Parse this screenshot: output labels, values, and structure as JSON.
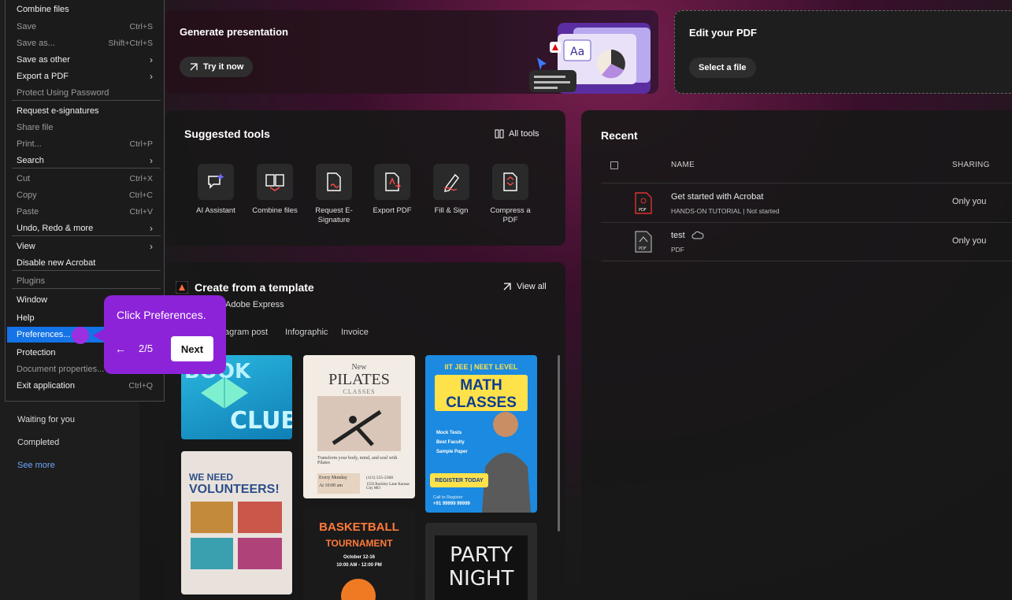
{
  "sidebar": {
    "links": [
      "Waiting for you",
      "Completed",
      "See more"
    ]
  },
  "banner": {
    "generate_title": "Generate presentation",
    "generate_button": "Try it now",
    "edit_title": "Edit your PDF",
    "edit_button": "Select a file"
  },
  "tools": {
    "title": "Suggested tools",
    "all_tools": "All tools",
    "items": [
      {
        "label": "AI Assistant",
        "icon": "ai-assistant-icon"
      },
      {
        "label": "Combine files",
        "icon": "combine-files-icon"
      },
      {
        "label": "Request E-Signature",
        "icon": "request-esignature-icon"
      },
      {
        "label": "Export PDF",
        "icon": "export-pdf-icon"
      },
      {
        "label": "Fill & Sign",
        "icon": "fill-sign-icon"
      },
      {
        "label": "Compress a PDF",
        "icon": "compress-pdf-icon"
      }
    ]
  },
  "templates": {
    "title": "Create from a template",
    "subtitle": "Adobe Express",
    "view_all": "View all",
    "tabs": [
      "tagram post",
      "Infographic",
      "Invoice"
    ],
    "thumbs": {
      "book": {
        "line1": "BOOK",
        "line2": "CLUB"
      },
      "pilates": {
        "line1": "New",
        "line2": "PILATES",
        "line3": "CLASSES",
        "line4": "Transform your body, mind, and soul with Pilates",
        "line5": "Every Monday",
        "line6": "At 10:00 am",
        "line7": "(111) 555-2368",
        "line8": "1556 Buckley Lane Kansas City MO"
      },
      "math": {
        "line1": "IIT JEE | NEET LEVEL",
        "line2": "MATH",
        "line3": "CLASSES",
        "b1": "Mock Tests",
        "b2": "Best Faculty",
        "b3": "Sample Paper",
        "cta": "REGISTER TODAY",
        "call": "Call to Register",
        "phone": "+91 99999 99999"
      },
      "volunteers": {
        "line1": "WE NEED",
        "line2": "VOLUNTEERS!"
      },
      "basketball": {
        "line1": "BASKETBALL",
        "line2": "TOURNAMENT",
        "line3": "October 12-16",
        "line4": "10:00 AM - 12:00 PM"
      },
      "party": {
        "line1": "PARTY",
        "line2": "NIGHT"
      }
    }
  },
  "recent": {
    "title": "Recent",
    "col_name": "NAME",
    "col_sharing": "SHARING",
    "files": [
      {
        "name": "Get started with Acrobat",
        "sub": "HANDS-ON TUTORIAL | Not started",
        "sharing": "Only you"
      },
      {
        "name": "test",
        "sub": "PDF",
        "sharing": "Only you"
      }
    ]
  },
  "menu": {
    "items": [
      {
        "label": "Combine files",
        "shortcut": "",
        "arrow": false,
        "dim": false
      },
      {
        "label": "Save",
        "shortcut": "Ctrl+S",
        "arrow": false,
        "dim": true
      },
      {
        "label": "Save as...",
        "shortcut": "Shift+Ctrl+S",
        "arrow": false,
        "dim": true
      },
      {
        "label": "Save as other",
        "shortcut": "",
        "arrow": true,
        "dim": false
      },
      {
        "label": "Export a PDF",
        "shortcut": "",
        "arrow": true,
        "dim": false
      },
      {
        "label": "Protect Using Password",
        "shortcut": "",
        "arrow": false,
        "dim": true
      },
      {
        "label": "Request e-signatures",
        "shortcut": "",
        "arrow": false,
        "dim": false
      },
      {
        "label": "Share file",
        "shortcut": "",
        "arrow": false,
        "dim": true
      },
      {
        "label": "Print...",
        "shortcut": "Ctrl+P",
        "arrow": false,
        "dim": true
      },
      {
        "label": "Search",
        "shortcut": "",
        "arrow": true,
        "dim": false
      },
      {
        "label": "Cut",
        "shortcut": "Ctrl+X",
        "arrow": false,
        "dim": true
      },
      {
        "label": "Copy",
        "shortcut": "Ctrl+C",
        "arrow": false,
        "dim": true
      },
      {
        "label": "Paste",
        "shortcut": "Ctrl+V",
        "arrow": false,
        "dim": true
      },
      {
        "label": "Undo, Redo & more",
        "shortcut": "",
        "arrow": true,
        "dim": false
      },
      {
        "label": "View",
        "shortcut": "",
        "arrow": true,
        "dim": false
      },
      {
        "label": "Disable new Acrobat",
        "shortcut": "",
        "arrow": false,
        "dim": false
      },
      {
        "label": "Plugins",
        "shortcut": "",
        "arrow": false,
        "dim": true
      },
      {
        "label": "Window",
        "shortcut": "",
        "arrow": false,
        "dim": false
      },
      {
        "label": "Help",
        "shortcut": "",
        "arrow": false,
        "dim": false
      },
      {
        "label": "Preferences...",
        "shortcut": "",
        "arrow": false,
        "dim": false,
        "selected": true
      },
      {
        "label": "Protection",
        "shortcut": "",
        "arrow": false,
        "dim": false
      },
      {
        "label": "Document properties...",
        "shortcut": "",
        "arrow": false,
        "dim": true
      },
      {
        "label": "Exit application",
        "shortcut": "Ctrl+Q",
        "arrow": false,
        "dim": false
      }
    ]
  },
  "tour": {
    "text": "Click Preferences.",
    "back": "←",
    "step": "2/5",
    "next": "Next"
  },
  "colors": {
    "accent": "#1473e6",
    "tour": "#8d23d8",
    "link": "#6aa7ff"
  }
}
